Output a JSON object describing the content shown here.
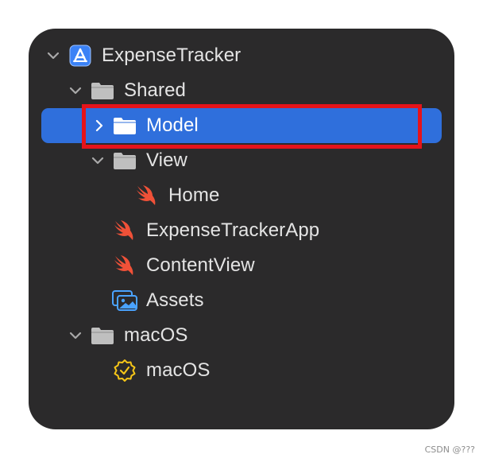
{
  "navigator": {
    "items": [
      {
        "label": "ExpenseTracker",
        "icon": "xcode-project-icon",
        "expanded": true
      },
      {
        "label": "Shared",
        "icon": "folder-icon",
        "expanded": true
      },
      {
        "label": "Model",
        "icon": "folder-icon",
        "expanded": false,
        "selected": true
      },
      {
        "label": "View",
        "icon": "folder-icon",
        "expanded": true
      },
      {
        "label": "Home",
        "icon": "swift-file-icon"
      },
      {
        "label": "ExpenseTrackerApp",
        "icon": "swift-file-icon"
      },
      {
        "label": "ContentView",
        "icon": "swift-file-icon"
      },
      {
        "label": "Assets",
        "icon": "asset-catalog-icon"
      },
      {
        "label": "macOS",
        "icon": "folder-icon",
        "expanded": true
      },
      {
        "label": "macOS",
        "icon": "entitlements-icon"
      }
    ]
  },
  "colors": {
    "panel_bg": "#2b2a2b",
    "selection": "#2f6fdc",
    "highlight_border": "#e5131a",
    "swift_orange": "#f05138",
    "badge_yellow": "#f5c518"
  },
  "watermark": "CSDN @???"
}
